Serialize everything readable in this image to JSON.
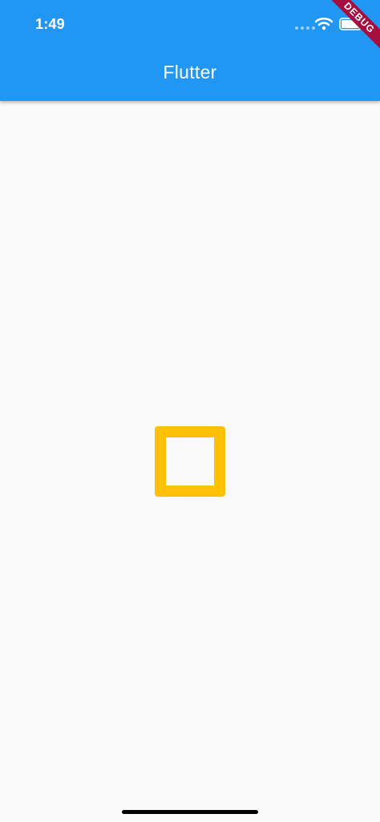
{
  "status_bar": {
    "time": "1:49",
    "icons": [
      "signal-dots-icon",
      "wifi-icon",
      "battery-icon"
    ]
  },
  "app_bar": {
    "title": "Flutter"
  },
  "debug_banner": {
    "label": "DEBUG"
  },
  "colors": {
    "app_bar": "#2196f3",
    "square_border": "#ffc107",
    "background": "#fafafa",
    "banner": "#a50e3f"
  }
}
